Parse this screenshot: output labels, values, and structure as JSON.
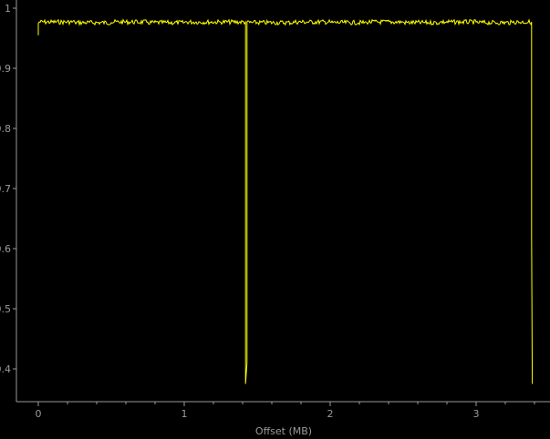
{
  "chart_data": {
    "type": "line",
    "title": "",
    "xlabel": "Offset (MB)",
    "ylabel": "",
    "xlim": [
      -0.15,
      3.5
    ],
    "ylim": [
      0.35,
      1.01
    ],
    "x_ticks": [
      0,
      1,
      2,
      3
    ],
    "x_tick_labels": [
      "0",
      "1",
      "2",
      "3"
    ],
    "y_ticks": [
      0.4,
      0.5,
      0.6,
      0.7,
      0.8,
      0.9,
      1.0
    ],
    "y_tick_labels": [
      "0.4",
      "0.5",
      "0.6",
      "0.7",
      "0.8",
      "0.9",
      "1"
    ],
    "grid": false,
    "colors": {
      "background": "#000000",
      "axis": "#9a9a9a",
      "line": "#ffff00"
    },
    "series": [
      {
        "values_note": "",
        "points": [
          [
            0.0,
            0.955
          ],
          [
            0.0,
            0.975
          ],
          [
            0.25,
            0.977
          ],
          [
            0.5,
            0.976
          ],
          [
            0.75,
            0.977
          ],
          [
            1.0,
            0.976
          ],
          [
            1.25,
            0.977
          ],
          [
            1.42,
            0.977
          ],
          [
            1.42,
            0.375
          ],
          [
            1.43,
            0.41
          ],
          [
            1.43,
            0.977
          ],
          [
            1.75,
            0.976
          ],
          [
            2.0,
            0.977
          ],
          [
            2.25,
            0.976
          ],
          [
            2.5,
            0.977
          ],
          [
            2.75,
            0.976
          ],
          [
            3.0,
            0.977
          ],
          [
            3.25,
            0.976
          ],
          [
            3.38,
            0.977
          ],
          [
            3.38,
            0.62
          ],
          [
            3.385,
            0.375
          ]
        ]
      }
    ]
  }
}
